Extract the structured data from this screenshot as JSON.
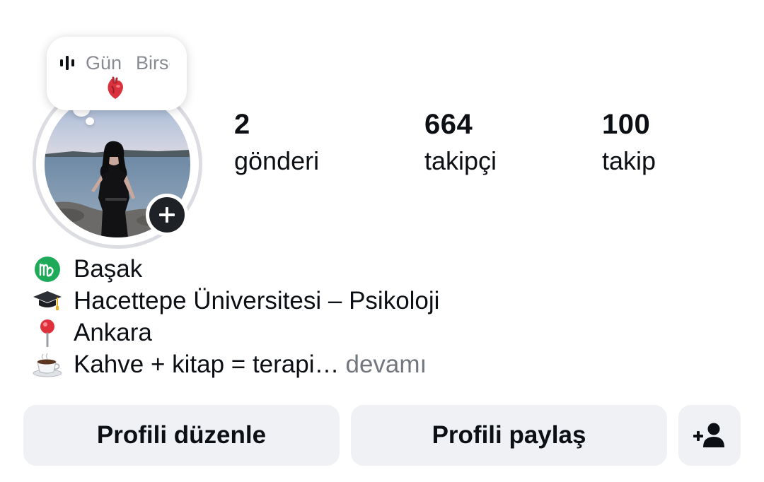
{
  "note": {
    "song": "Bir Gün",
    "artist": "Birsen",
    "music_icon": "audio-bars-icon",
    "emoji_icon": "anatomical-heart-emoji"
  },
  "stats": [
    {
      "value": "2",
      "label": "gönderi"
    },
    {
      "value": "664",
      "label": "takipçi"
    },
    {
      "value": "100",
      "label": "takip"
    }
  ],
  "bio": {
    "lines": [
      {
        "icon": "virgo-icon",
        "text": "Başak"
      },
      {
        "icon": "graduation-cap-icon",
        "text": "Hacettepe Üniversitesi – Psikoloji"
      },
      {
        "icon": "pin-icon",
        "text": "Ankara"
      },
      {
        "icon": "coffee-icon",
        "text": "Kahve + kitap = terapi…"
      }
    ],
    "more_label": "devamı"
  },
  "buttons": {
    "edit_profile": "Profili düzenle",
    "share_profile": "Profili paylaş",
    "discover_people_icon": "add-person-icon"
  },
  "colors": {
    "button_bg": "#eff1f5",
    "text": "#0c1014",
    "muted": "#72777e",
    "story_ring": "#dbdde2"
  }
}
